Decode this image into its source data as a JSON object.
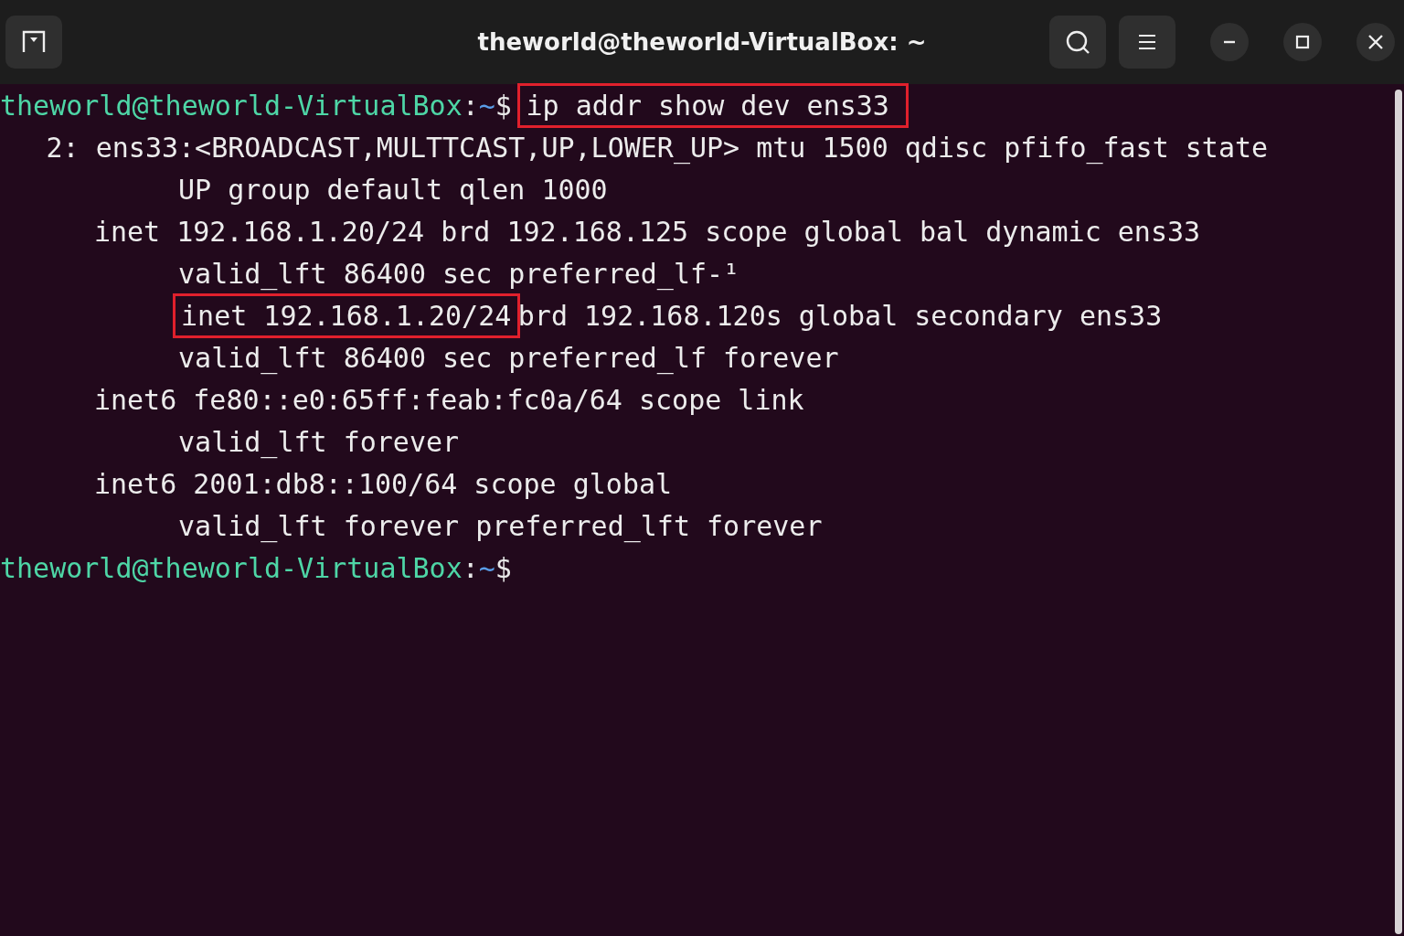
{
  "window": {
    "title": "theworld@theworld-VirtualBox: ~"
  },
  "terminal": {
    "lines": [
      {
        "kind": "prompt",
        "user_host": "theworld@theworld-VirtualBox",
        "separator": ":",
        "path": "~",
        "symbol": "$",
        "command": "ip addr show dev ens33",
        "highlighted": true
      },
      {
        "kind": "interface",
        "segments": [
          {
            "text": "2: ens33:<BROADCAST,MULTTCAST,UP,LOWER_UP> mtu 1500 qdisc pfifo_fast state",
            "highlighted": false
          }
        ]
      },
      {
        "kind": "continuation",
        "segments": [
          {
            "text": "UP group default qlen 1000",
            "highlighted": false
          }
        ]
      },
      {
        "kind": "address",
        "segments": [
          {
            "text": "inet 192.168.1.20/24 brd 192.168.125 scope global bal dynamic ens33",
            "highlighted": false
          }
        ]
      },
      {
        "kind": "continuation",
        "segments": [
          {
            "text": "valid_lft 86400 sec preferred_lf-¹",
            "highlighted": false
          }
        ]
      },
      {
        "kind": "continuation",
        "segments": [
          {
            "text": "inet 192.168.1.20/24",
            "highlighted": true
          },
          {
            "text": "brd 192.168.120s global secondary ens33",
            "highlighted": false
          }
        ]
      },
      {
        "kind": "continuation",
        "segments": [
          {
            "text": "valid_lft 86400 sec preferred_lf forever",
            "highlighted": false
          }
        ]
      },
      {
        "kind": "address",
        "segments": [
          {
            "text": "inet6 fe80::e0:65ff:feab:fc0a/64 scope link",
            "highlighted": false
          }
        ]
      },
      {
        "kind": "continuation",
        "segments": [
          {
            "text": "valid_lft forever",
            "highlighted": false
          }
        ]
      },
      {
        "kind": "address",
        "segments": [
          {
            "text": "inet6 2001:db8::100/64 scope global",
            "highlighted": false
          }
        ]
      },
      {
        "kind": "continuation",
        "segments": [
          {
            "text": "valid_lft forever preferred_lft forever",
            "highlighted": false
          }
        ]
      },
      {
        "kind": "prompt",
        "user_host": "theworld@theworld-VirtualBox",
        "separator": ":",
        "path": "~",
        "symbol": "$"
      }
    ]
  }
}
